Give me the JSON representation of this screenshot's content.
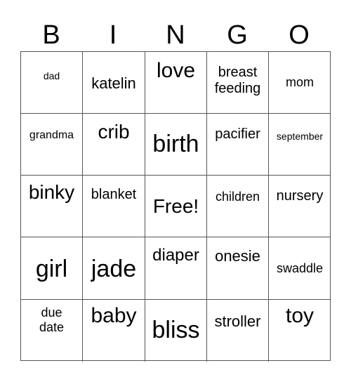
{
  "header": [
    "B",
    "I",
    "N",
    "G",
    "O"
  ],
  "cells": [
    [
      "dad",
      "katelin",
      "love",
      "breast feeding",
      "mom"
    ],
    [
      "grandma",
      "crib",
      "birth",
      "pacifier",
      "september"
    ],
    [
      "binky",
      "blanket",
      "Free!",
      "children",
      "nursery"
    ],
    [
      "girl",
      "jade",
      "diaper",
      "onesie",
      "swaddle"
    ],
    [
      "due date",
      "baby",
      "bliss",
      "stroller",
      "toy"
    ]
  ]
}
